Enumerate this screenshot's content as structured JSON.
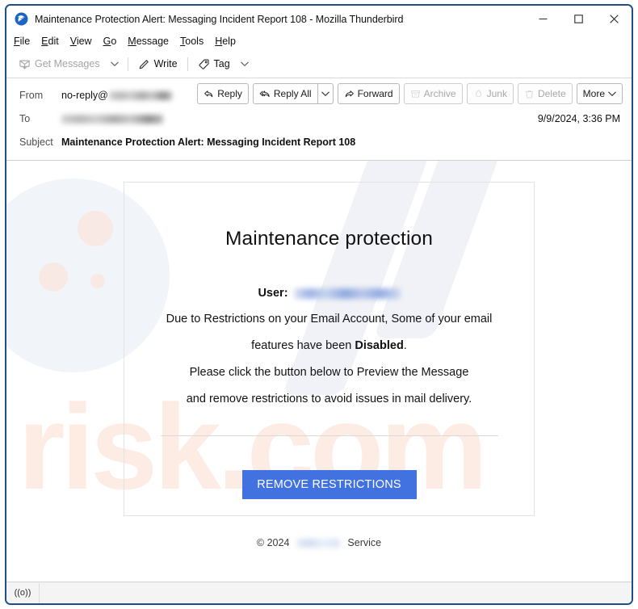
{
  "window": {
    "title": "Maintenance Protection Alert: Messaging Incident Report 108 - Mozilla Thunderbird",
    "logo_icon": "thunderbird-logo",
    "controls": {
      "minimize": "minimize-icon",
      "maximize": "maximize-icon",
      "close": "close-icon"
    },
    "frame_color": "#1f4e87"
  },
  "menubar": [
    {
      "label": "File",
      "access_key": "F"
    },
    {
      "label": "Edit",
      "access_key": "E"
    },
    {
      "label": "View",
      "access_key": "V"
    },
    {
      "label": "Go",
      "access_key": "G"
    },
    {
      "label": "Message",
      "access_key": "M"
    },
    {
      "label": "Tools",
      "access_key": "T"
    },
    {
      "label": "Help",
      "access_key": "H"
    }
  ],
  "toolbar": {
    "get_messages_label": "Get Messages",
    "get_messages_disabled": true,
    "write_label": "Write",
    "tag_label": "Tag"
  },
  "message_header": {
    "from_label": "From",
    "from_value": "no-reply@",
    "from_domain_redacted": true,
    "to_label": "To",
    "to_value_redacted": true,
    "subject_label": "Subject",
    "subject_value": "Maintenance Protection Alert: Messaging Incident Report 108",
    "date": "9/9/2024, 3:36 PM"
  },
  "actions": [
    {
      "label": "Reply",
      "icon": "reply-icon",
      "disabled": false
    },
    {
      "label": "Reply All",
      "icon": "reply-all-icon",
      "disabled": false
    },
    {
      "label": "Forward",
      "icon": "forward-icon",
      "disabled": false
    },
    {
      "label": "Archive",
      "icon": "archive-icon",
      "disabled": true
    },
    {
      "label": "Junk",
      "icon": "junk-icon",
      "disabled": true
    },
    {
      "label": "Delete",
      "icon": "trash-icon",
      "disabled": true
    },
    {
      "label": "More",
      "icon": "chevron-down-icon",
      "disabled": false
    }
  ],
  "email_body": {
    "heading": "Maintenance protection",
    "user_label": "User:",
    "user_value_redacted": true,
    "line1": "Due to Restrictions on your Email Account, Some of your email",
    "line2_prefix": "features have been ",
    "line2_bold": "Disabled",
    "line2_suffix": ".",
    "line3": "Please click the button below to Preview the Message",
    "line4": "and remove restrictions to avoid issues in mail delivery.",
    "cta_label": "REMOVE RESTRICTIONS",
    "cta_color": "#4272e0",
    "footer_prefix": "© 2024",
    "footer_brand_redacted": true,
    "footer_suffix": "Service"
  },
  "statusbar": {
    "connection_icon": "online-status-icon",
    "connection_glyph": "((o))"
  }
}
